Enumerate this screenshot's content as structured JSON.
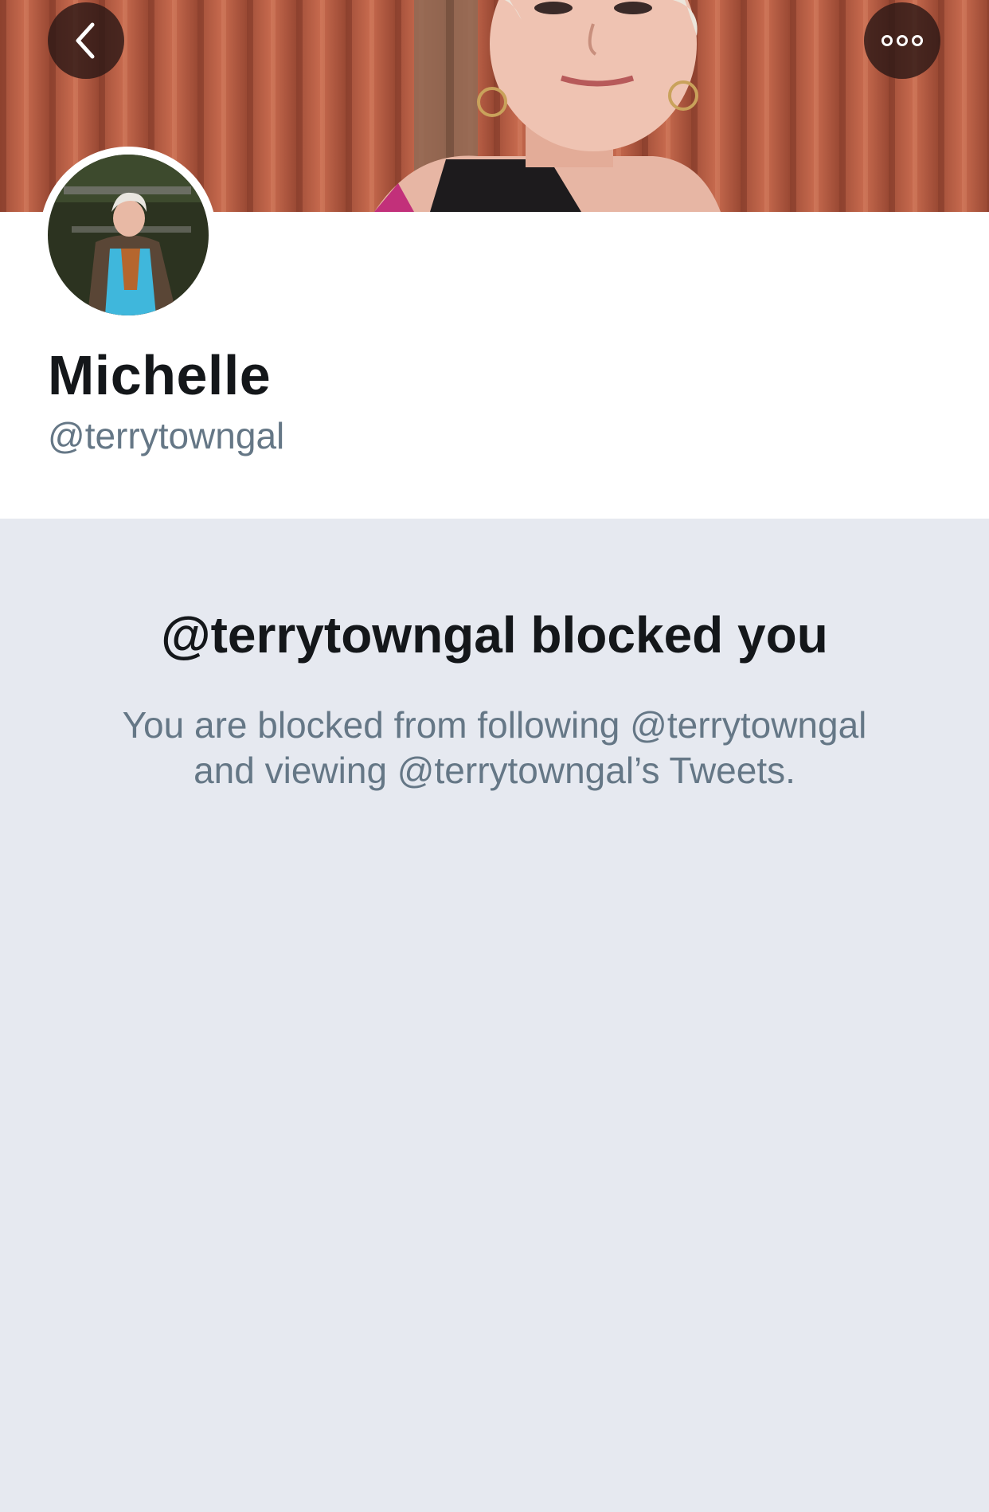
{
  "header": {
    "back_icon": "chevron-left-icon",
    "more_icon": "more-horizontal-icon"
  },
  "profile": {
    "display_name": "Michelle",
    "handle": "@terrytowngal"
  },
  "blocked": {
    "title": "@terrytowngal blocked you",
    "description_line1": "You are blocked from following @terrytowngal",
    "description_line2": "and viewing @terrytowngal’s Tweets."
  },
  "colors": {
    "page_background": "#e6e9f0",
    "card_background": "#ffffff",
    "primary_text": "#14171a",
    "secondary_text": "#657786",
    "button_overlay": "#2d1916"
  }
}
